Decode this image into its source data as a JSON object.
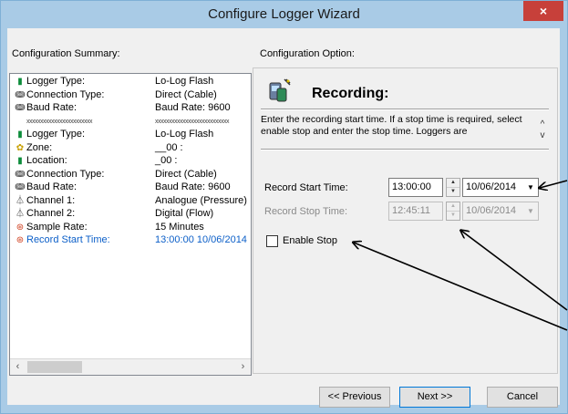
{
  "window": {
    "title": "Configure Logger Wizard",
    "close_glyph": "×"
  },
  "summary": {
    "label": "Configuration Summary:",
    "rows": [
      {
        "icon": "logger-icon",
        "glyph": "▮",
        "color": "#0c8c3a",
        "key": "Logger Type:",
        "value": "Lo-Log Flash"
      },
      {
        "icon": "cable-icon",
        "glyph": "ↈ",
        "color": "#555555",
        "key": "Connection Type:",
        "value": "Direct (Cable)"
      },
      {
        "icon": "cable-icon",
        "glyph": "ↈ",
        "color": "#555555",
        "key": "Baud Rate:",
        "value": "Baud Rate: 9600"
      },
      {
        "icon": "",
        "glyph": "",
        "color": "#444444",
        "key": "xxxxxxxxxxxxxxxxxxxxxxxx",
        "value": "xxxxxxxxxxxxxxxxxxxxxxxxxxx",
        "sep": true
      },
      {
        "icon": "logger-icon",
        "glyph": "▮",
        "color": "#0c8c3a",
        "key": "Logger Type:",
        "value": "Lo-Log Flash"
      },
      {
        "icon": "zone-icon",
        "glyph": "✿",
        "color": "#c8a000",
        "key": "Zone:",
        "value": "__00 :"
      },
      {
        "icon": "location-icon",
        "glyph": "▮",
        "color": "#0c8c3a",
        "key": "Location:",
        "value": "_00 :"
      },
      {
        "icon": "cable-icon",
        "glyph": "ↈ",
        "color": "#555555",
        "key": "Connection Type:",
        "value": "Direct (Cable)"
      },
      {
        "icon": "cable-icon",
        "glyph": "ↈ",
        "color": "#555555",
        "key": "Baud Rate:",
        "value": "Baud Rate: 9600"
      },
      {
        "icon": "channel-icon",
        "glyph": "⏃",
        "color": "#333333",
        "key": "Channel 1:",
        "value": "Analogue (Pressure)"
      },
      {
        "icon": "channel-icon",
        "glyph": "⏃",
        "color": "#333333",
        "key": "Channel 2:",
        "value": "Digital (Flow)"
      },
      {
        "icon": "clock-icon",
        "glyph": "⊛",
        "color": "#d04020",
        "key": "Sample Rate:",
        "value": "15 Minutes"
      },
      {
        "icon": "clock-icon",
        "glyph": "⊛",
        "color": "#d04020",
        "key": "Record Start Time:",
        "value": "13:00:00 10/06/2014",
        "active": true
      }
    ],
    "scroll_left": "‹",
    "scroll_right": "›"
  },
  "option": {
    "label": "Configuration Option:",
    "heading": "Recording:",
    "description": "Enter the recording start time. If a stop time is required, select enable stop and enter the stop time. Loggers are",
    "desc_up": "^",
    "desc_down": "v",
    "start_label": "Record Start Time:",
    "start_time": "13:00:00",
    "start_date": "10/06/2014",
    "stop_label": "Record Stop Time:",
    "stop_time": "12:45:11",
    "stop_date": "10/06/2014",
    "enable_stop_label": "Enable Stop",
    "enable_stop_checked": false,
    "spin_up": "▲",
    "spin_down": "▼",
    "dropdown": "▼"
  },
  "buttons": {
    "previous": "<< Previous",
    "next": "Next >>",
    "cancel": "Cancel"
  },
  "colors": {
    "title_bar": "#a9cbe6",
    "close": "#c7403a",
    "active_text": "#0c5fc8",
    "annotation": "#000000"
  }
}
